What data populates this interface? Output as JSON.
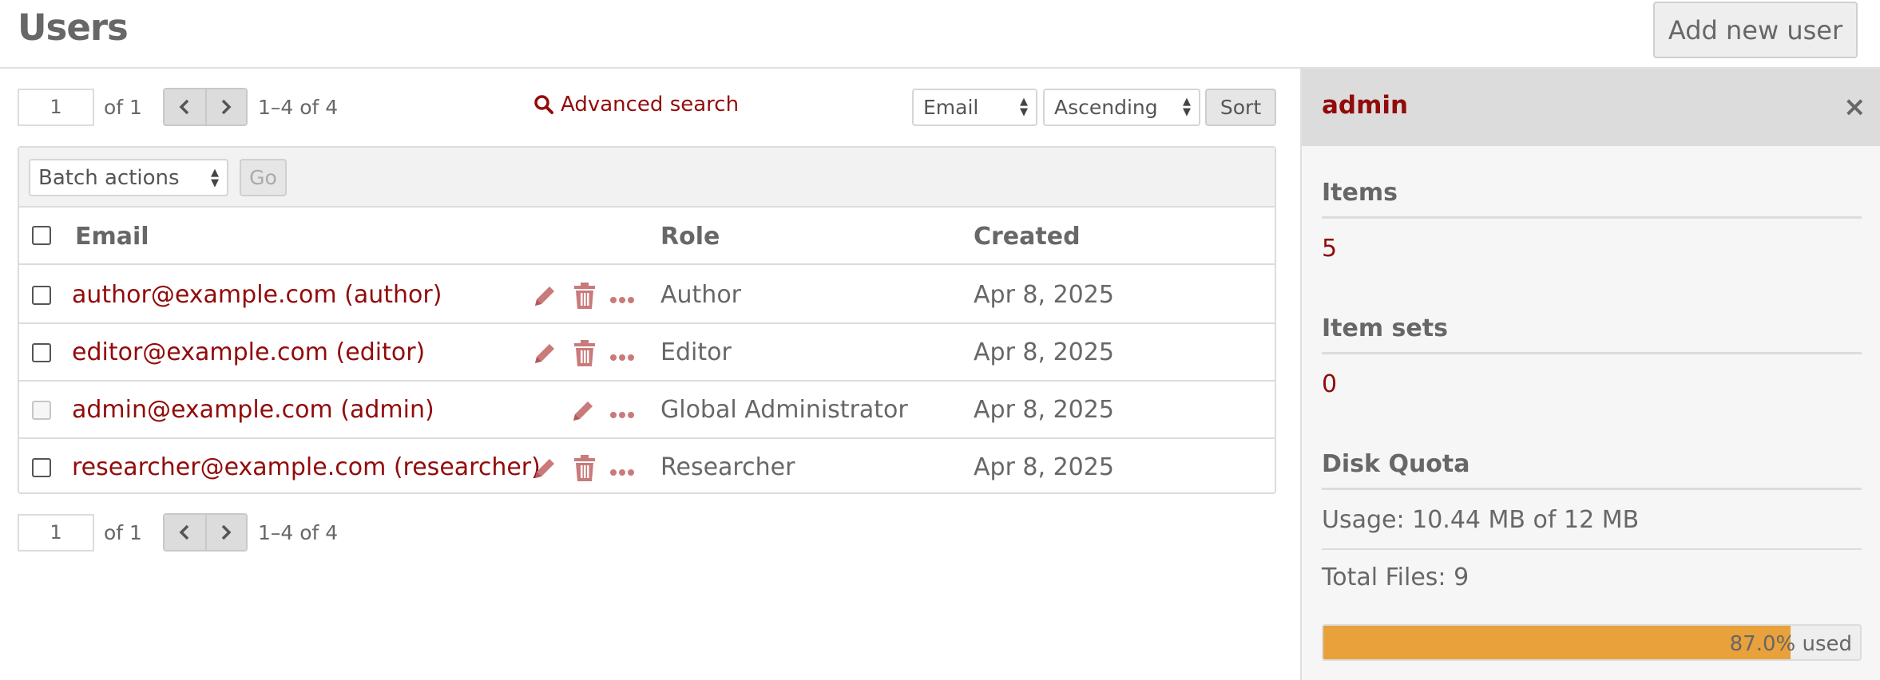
{
  "header": {
    "title": "Users",
    "add_button": "Add new user"
  },
  "pagination_top": {
    "page": "1",
    "of": "of 1",
    "range": "1–4 of 4"
  },
  "pagination_bottom": {
    "page": "1",
    "of": "of 1",
    "range": "1–4 of 4"
  },
  "advanced_search": {
    "label": "Advanced search",
    "icon": "search-icon"
  },
  "sort": {
    "by": "Email",
    "order": "Ascending",
    "button": "Sort"
  },
  "batch": {
    "select": "Batch actions",
    "go": "Go"
  },
  "table": {
    "columns": {
      "email": "Email",
      "role": "Role",
      "created": "Created"
    },
    "rows": [
      {
        "email": "author@example.com (author)",
        "role": "Author",
        "created": "Apr 8, 2025",
        "can_delete": true
      },
      {
        "email": "editor@example.com (editor)",
        "role": "Editor",
        "created": "Apr 8, 2025",
        "can_delete": true
      },
      {
        "email": "admin@example.com (admin)",
        "role": "Global Administrator",
        "created": "Apr 8, 2025",
        "can_delete": false
      },
      {
        "email": "researcher@example.com (researcher)",
        "role": "Researcher",
        "created": "Apr 8, 2025",
        "can_delete": true
      }
    ]
  },
  "sidebar": {
    "title": "admin",
    "close": "×",
    "items_heading": "Items",
    "items_value": "5",
    "item_sets_heading": "Item sets",
    "item_sets_value": "0",
    "disk_quota_heading": "Disk Quota",
    "usage": "Usage: 10.44 MB of 12 MB",
    "total_files": "Total Files: 9",
    "used_label": "87.0% used",
    "used_fraction": 0.87
  },
  "colors": {
    "link": "#920b0b",
    "icon": "#c97a7a",
    "progress": "#e8a13b"
  }
}
